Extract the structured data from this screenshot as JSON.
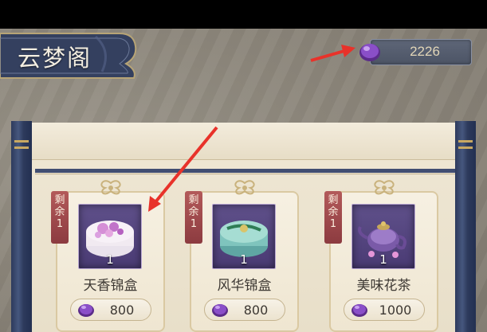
{
  "header": {
    "title": "云梦阁"
  },
  "currency": {
    "amount": "2226",
    "icon": "purple-gem-icon"
  },
  "shop_items": [
    {
      "stock_label_1": "剩",
      "stock_label_2": "余",
      "stock_count": "1",
      "quantity": "1",
      "name": "天香锦盒",
      "price": "800"
    },
    {
      "stock_label_1": "剩",
      "stock_label_2": "余",
      "stock_count": "1",
      "quantity": "1",
      "name": "风华锦盒",
      "price": "800"
    },
    {
      "stock_label_1": "剩",
      "stock_label_2": "余",
      "stock_count": "1",
      "quantity": "1",
      "name": "美味花茶",
      "price": "1000"
    }
  ],
  "colors": {
    "accent_red": "#e8322a",
    "gem_purple": "#7a3fb0",
    "rod_blue": "#2d3a5c"
  }
}
